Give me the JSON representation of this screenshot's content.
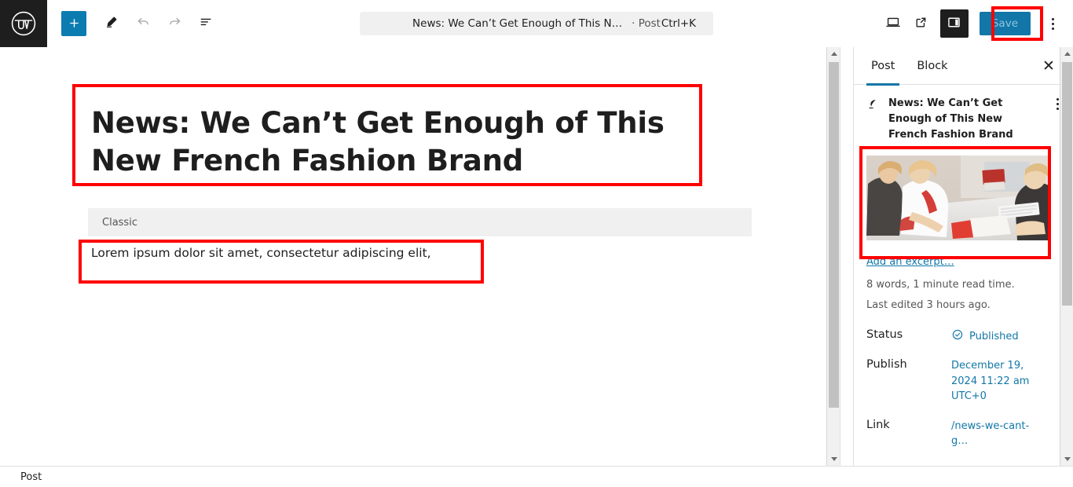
{
  "toolbar": {
    "logo_icon": "wordpress-logo",
    "add_label": "+",
    "add_icon": "plus-icon",
    "edit_icon": "pencil-icon",
    "undo_icon": "undo-arrow-icon",
    "redo_icon": "redo-arrow-icon",
    "list_view_icon": "document-overview-icon",
    "view_icon": "laptop-preview-icon",
    "external_icon": "view-post-external-icon",
    "sidebar_toggle_icon": "settings-panel-toggle-icon",
    "options_icon": "kebab-menu-icon",
    "save_label": "Save"
  },
  "command_bar": {
    "title": "News: We Can’t Get Enough of This N…",
    "separator": "· Post",
    "shortcut": "Ctrl+K"
  },
  "editor": {
    "post_title": "News: We Can’t Get Enough of This New French Fashion Brand",
    "classic_block_label": "Classic",
    "classic_block_text": "Lorem ipsum dolor sit amet, consectetur adipiscing elit,"
  },
  "sidebar": {
    "tabs": [
      {
        "label": "Post",
        "active": true
      },
      {
        "label": "Block",
        "active": false
      }
    ],
    "close_icon": "close-icon",
    "close_label": "✕",
    "post_icon": "feather-post-icon",
    "post_title": "News: We Can’t Get Enough of This New French Fashion Brand",
    "kebab_icon": "kebab-menu-icon",
    "featured_image_alt": "featured-image-people-at-desk",
    "excerpt_link": "Add an excerpt…",
    "word_count": "8 words, 1 minute read time.",
    "last_edited": "Last edited 3 hours ago.",
    "rows": [
      {
        "label": "Status",
        "value": "Published",
        "icon": "published-check-icon"
      },
      {
        "label": "Publish",
        "value": "December 19, 2024 11:22 am UTC+0"
      },
      {
        "label": "Link",
        "value": "/news-we-cant-g…"
      }
    ]
  },
  "statusbar": {
    "label": "Post"
  },
  "colors": {
    "accent": "#1277a8",
    "add_button": "#0b7cb0",
    "annotation": "#ff0000",
    "dark": "#1e1e1e"
  }
}
